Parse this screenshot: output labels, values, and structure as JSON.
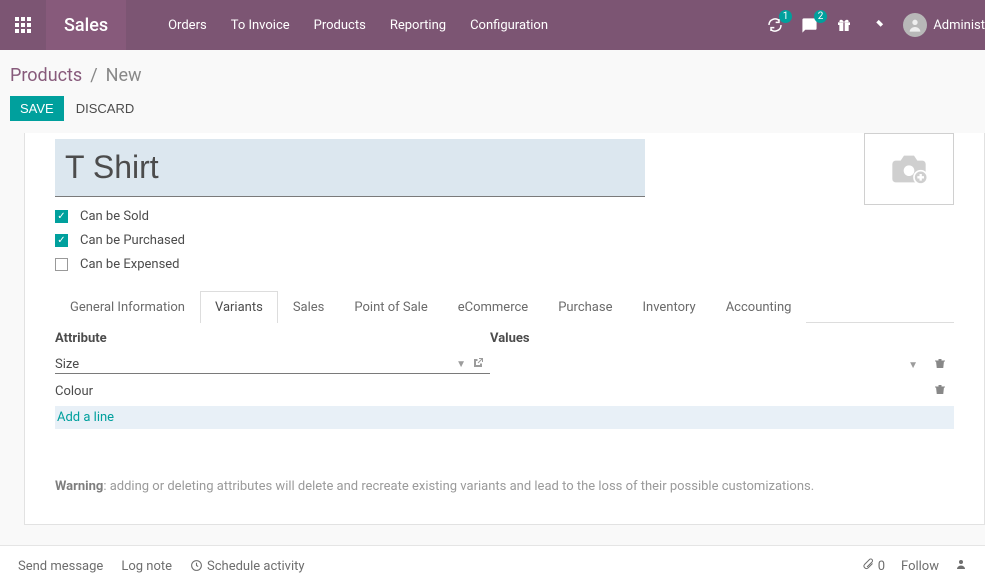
{
  "topbar": {
    "app_title": "Sales",
    "nav": [
      "Orders",
      "To Invoice",
      "Products",
      "Reporting",
      "Configuration"
    ],
    "badge_refresh": "1",
    "badge_chat": "2",
    "user_name": "Administ"
  },
  "breadcrumb": {
    "root": "Products",
    "current": "New"
  },
  "actions": {
    "save": "SAVE",
    "discard": "DISCARD"
  },
  "form": {
    "name_value": "T Shirt",
    "checks": [
      {
        "label": "Can be Sold",
        "checked": true
      },
      {
        "label": "Can be Purchased",
        "checked": true
      },
      {
        "label": "Can be Expensed",
        "checked": false
      }
    ],
    "tabs": [
      "General Information",
      "Variants",
      "Sales",
      "Point of Sale",
      "eCommerce",
      "Purchase",
      "Inventory",
      "Accounting"
    ],
    "active_tab_index": 1,
    "attr_headers": {
      "attribute": "Attribute",
      "values": "Values"
    },
    "attributes": [
      {
        "name": "Size",
        "editing": true
      },
      {
        "name": "Colour",
        "editing": false
      }
    ],
    "add_line": "Add a line",
    "warning_label": "Warning",
    "warning_text": ": adding or deleting attributes will delete and recreate existing variants and lead to the loss of their possible customizations."
  },
  "chatter": {
    "send": "Send message",
    "log": "Log note",
    "schedule": "Schedule activity",
    "attach_count": "0",
    "follow": "Follow"
  }
}
